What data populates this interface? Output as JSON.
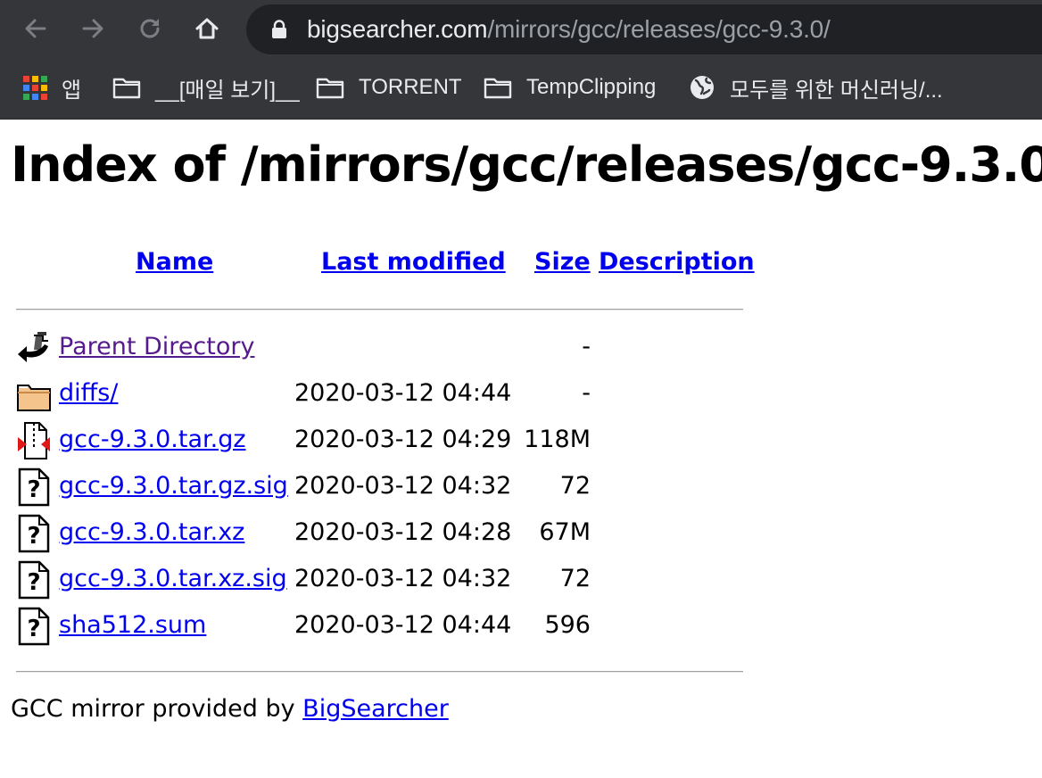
{
  "browser": {
    "url_host": "bigsearcher.com",
    "url_path": "/mirrors/gcc/releases/gcc-9.3.0/",
    "bookmarks": [
      {
        "label": "앱",
        "icon": "apps-grid-icon"
      },
      {
        "label": "__[매일 보기]__",
        "icon": "folder-icon"
      },
      {
        "label": "TORRENT",
        "icon": "folder-icon"
      },
      {
        "label": "TempClipping",
        "icon": "folder-icon"
      },
      {
        "label": "모두를 위한 머신러닝/...",
        "icon": "globe-icon"
      }
    ]
  },
  "page": {
    "title": "Index of /mirrors/gcc/releases/gcc-9.3.0",
    "columns": {
      "name": "Name",
      "last_modified": "Last modified",
      "size": "Size",
      "description": "Description"
    },
    "rows": [
      {
        "icon": "back-arrow-icon",
        "name": "Parent Directory",
        "date": "",
        "size": "-",
        "visited": true
      },
      {
        "icon": "folder-icon",
        "name": "diffs/",
        "date": "2020-03-12 04:44",
        "size": "-",
        "visited": false
      },
      {
        "icon": "compressed-file-icon",
        "name": "gcc-9.3.0.tar.gz",
        "date": "2020-03-12 04:29",
        "size": "118M",
        "visited": false
      },
      {
        "icon": "unknown-file-icon",
        "name": "gcc-9.3.0.tar.gz.sig",
        "date": "2020-03-12 04:32",
        "size": "72",
        "visited": false
      },
      {
        "icon": "unknown-file-icon",
        "name": "gcc-9.3.0.tar.xz",
        "date": "2020-03-12 04:28",
        "size": "67M",
        "visited": false
      },
      {
        "icon": "unknown-file-icon",
        "name": "gcc-9.3.0.tar.xz.sig",
        "date": "2020-03-12 04:32",
        "size": "72",
        "visited": false
      },
      {
        "icon": "unknown-file-icon",
        "name": "sha512.sum",
        "date": "2020-03-12 04:44",
        "size": "596",
        "visited": false
      }
    ],
    "footer_text": "GCC mirror provided by ",
    "footer_link": "BigSearcher"
  },
  "colors": {
    "chrome_bg": "#35363a",
    "omnibox_bg": "#202124",
    "link": "#0000ee",
    "visited_link": "#551a8b"
  }
}
